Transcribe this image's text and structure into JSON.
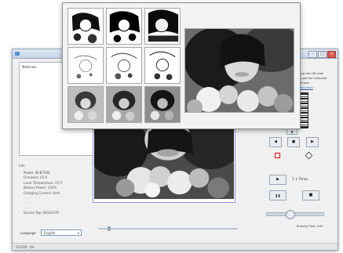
{
  "app": {
    "title": "",
    "window_buttons": {
      "minimize": "–",
      "maximize": "□",
      "close": "×"
    }
  },
  "left_panel": {
    "list_label": "Materials",
    "status_group_label": "Info",
    "status_items": [
      "Model: EK-B7000",
      "Firmware: V2.0",
      "Laser Temperature: 25°C",
      "Battery Power: 100%",
      "Charging Current: 0mA",
      "------",
      "------",
      "------",
      "Device Tag: 000A3279"
    ],
    "language_label": "Language",
    "language_value": "English",
    "status_bar": "V3.676 - Ok"
  },
  "right_panel": {
    "info_lines": [
      "Scan the QR code",
      "to get the Computer",
      "version"
    ],
    "link_text": "Read here",
    "times_label": "Times",
    "times_value": "1",
    "remaining_label": "Burning Time: 0:00"
  },
  "controls": {
    "up": "▲",
    "left": "◀",
    "right": "▶",
    "down": "▼",
    "center": "●",
    "play": "▶",
    "pause": "❚❚",
    "stop": "■"
  },
  "colors": {
    "accent": "#5b8fd0",
    "preview_border": "#8c93d8",
    "red_square": "#dd0000"
  },
  "icons": {
    "app": "app-icon",
    "qr": "qr-code-icon"
  }
}
